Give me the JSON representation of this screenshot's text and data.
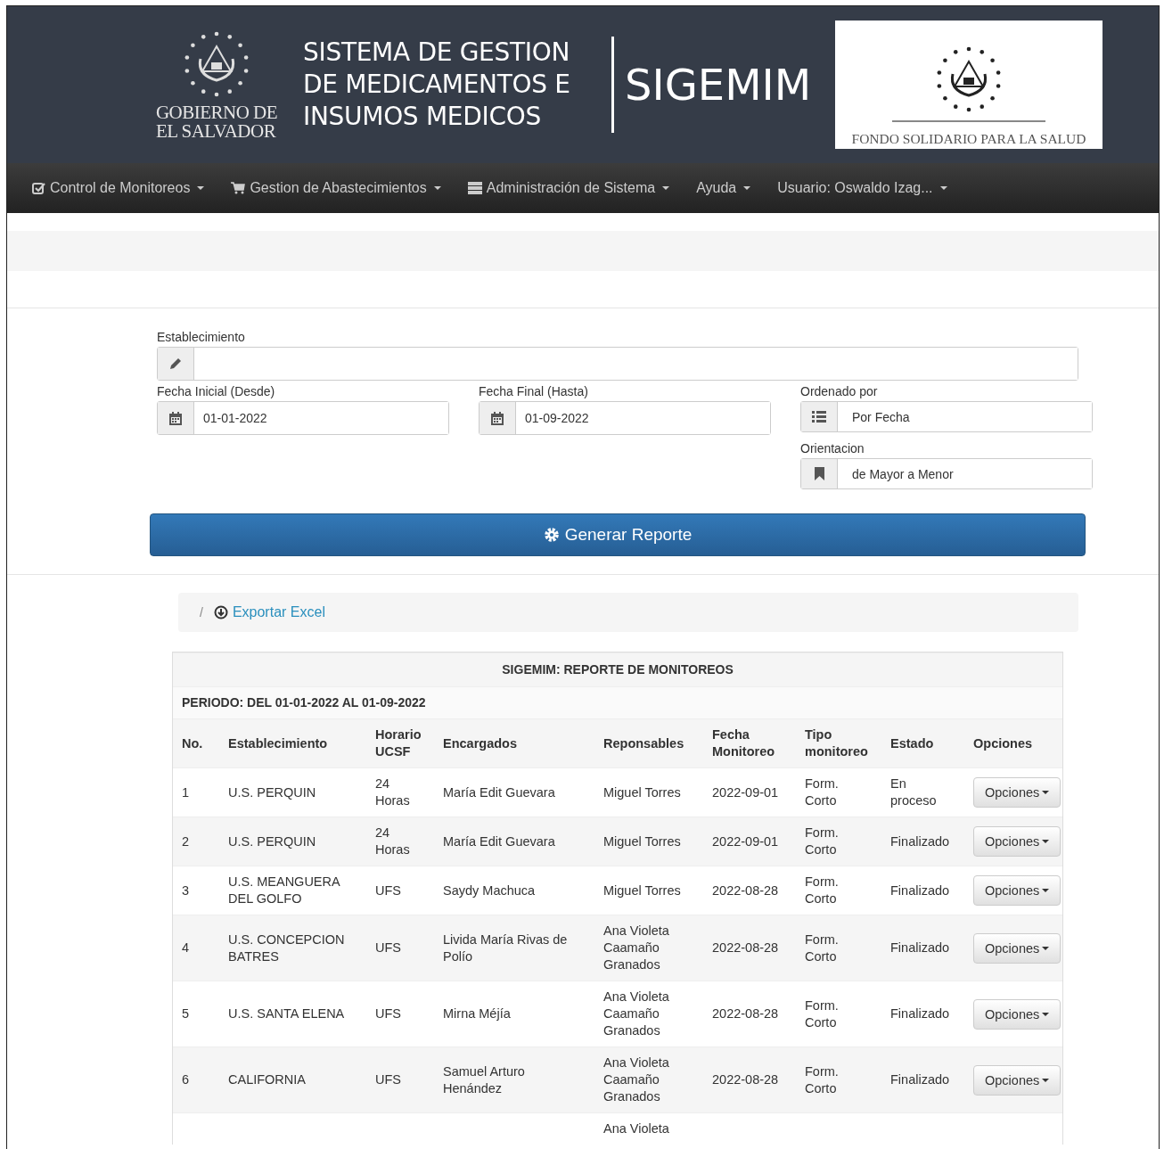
{
  "header": {
    "government_lines": [
      "GOBIERNO DE",
      "EL SALVADOR"
    ],
    "title_lines": [
      "SISTEMA DE GESTION",
      "DE MEDICAMENTOS E",
      "INSUMOS MEDICOS"
    ],
    "acronym": "SIGEMIM",
    "fund_caption": "FONDO SOLIDARIO PARA LA SALUD"
  },
  "nav": [
    {
      "label": "Control de Monitoreos"
    },
    {
      "label": "Gestion de Abastecimientos"
    },
    {
      "label": "Administración de Sistema"
    },
    {
      "label": "Ayuda"
    },
    {
      "label": "Usuario: Oswaldo Izag..."
    }
  ],
  "form": {
    "establecimiento": {
      "label": "Establecimiento"
    },
    "fecha_inicial": {
      "label": "Fecha Inicial (Desde)",
      "value": "01-01-2022"
    },
    "fecha_final": {
      "label": "Fecha Final (Hasta)",
      "value": "01-09-2022"
    },
    "ordenado_por": {
      "label": "Ordenado por",
      "value": "Por Fecha"
    },
    "orientacion": {
      "label": "Orientacion",
      "value": "de Mayor a Menor"
    },
    "submit": "Generar Reporte"
  },
  "breadcrumb": {
    "separator": "/",
    "link": "Exportar Excel"
  },
  "table": {
    "title": "SIGEMIM: REPORTE DE MONITOREOS",
    "period": "PERIODO: DEL 01-01-2022 AL 01-09-2022",
    "columns": [
      "No.",
      "Establecimiento",
      "Horario UCSF",
      "Encargados",
      "Reponsables",
      "Fecha Monitoreo",
      "Tipo monitoreo",
      "Estado",
      "Opciones"
    ],
    "rows": [
      {
        "no": "1",
        "establecimiento": "U.S. PERQUIN",
        "horario": "24 Horas",
        "encargados": "María Edit Guevara",
        "responsables": "Miguel Torres",
        "fecha": "2022-09-01",
        "tipo": "Form. Corto",
        "estado": "En proceso",
        "button": "Opciones"
      },
      {
        "no": "2",
        "establecimiento": "U.S. PERQUIN",
        "horario": "24 Horas",
        "encargados": "María Edit Guevara",
        "responsables": "Miguel Torres",
        "fecha": "2022-09-01",
        "tipo": "Form. Corto",
        "estado": "Finalizado",
        "button": "Opciones"
      },
      {
        "no": "3",
        "establecimiento": "U.S. MEANGUERA DEL GOLFO",
        "horario": "UFS",
        "encargados": "Saydy Machuca",
        "responsables": "Miguel Torres",
        "fecha": "2022-08-28",
        "tipo": "Form. Corto",
        "estado": "Finalizado",
        "button": "Opciones"
      },
      {
        "no": "4",
        "establecimiento": "U.S. CONCEPCION BATRES",
        "horario": "UFS",
        "encargados": "Livida María Rivas de Polío",
        "responsables": "Ana Violeta Caamaño Granados",
        "fecha": "2022-08-28",
        "tipo": "Form. Corto",
        "estado": "Finalizado",
        "button": "Opciones"
      },
      {
        "no": "5",
        "establecimiento": "U.S. SANTA ELENA",
        "horario": "UFS",
        "encargados": "Mirna Méjía",
        "responsables": "Ana Violeta Caamaño Granados",
        "fecha": "2022-08-28",
        "tipo": "Form. Corto",
        "estado": "Finalizado",
        "button": "Opciones"
      },
      {
        "no": "6",
        "establecimiento": "CALIFORNIA",
        "horario": "UFS",
        "encargados": "Samuel Arturo Henández",
        "responsables": "Ana Violeta Caamaño Granados",
        "fecha": "2022-08-28",
        "tipo": "Form. Corto",
        "estado": "Finalizado",
        "button": "Opciones"
      },
      {
        "responsables": "Ana Violeta"
      }
    ]
  }
}
